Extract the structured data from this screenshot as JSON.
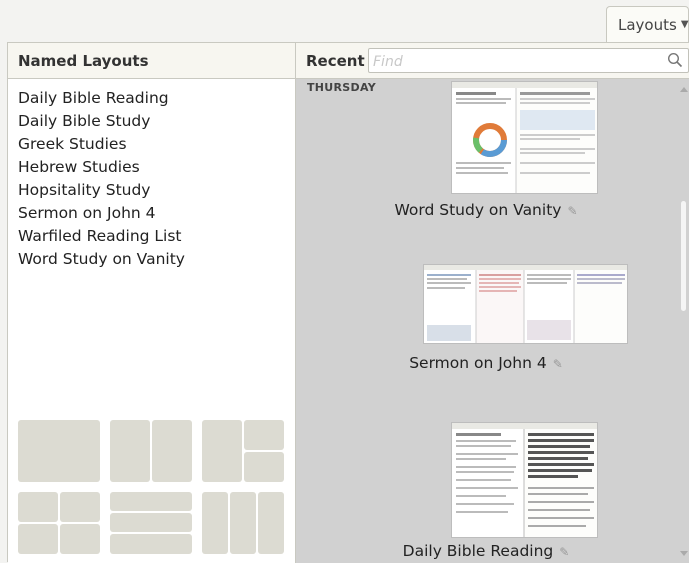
{
  "header": {
    "layouts_button": "Layouts"
  },
  "named_layouts": {
    "title": "Named Layouts",
    "items": [
      "Daily Bible Reading",
      "Daily Bible Study",
      "Greek Studies",
      "Hebrew Studies",
      "Hopsitality Study",
      "Sermon on John 4",
      "Warfiled Reading List",
      "Word Study on Vanity"
    ]
  },
  "recent": {
    "title": "Recent",
    "search_placeholder": "Find",
    "day_label": "THURSDAY",
    "entries": [
      {
        "title": "Word Study on Vanity"
      },
      {
        "title": "Sermon on John 4"
      },
      {
        "title": "Daily Bible Reading"
      }
    ]
  },
  "colors": {
    "tile_fill": "#dcdbd2",
    "recent_background": "#d1d1d1",
    "header_background": "#f7f6f0"
  }
}
